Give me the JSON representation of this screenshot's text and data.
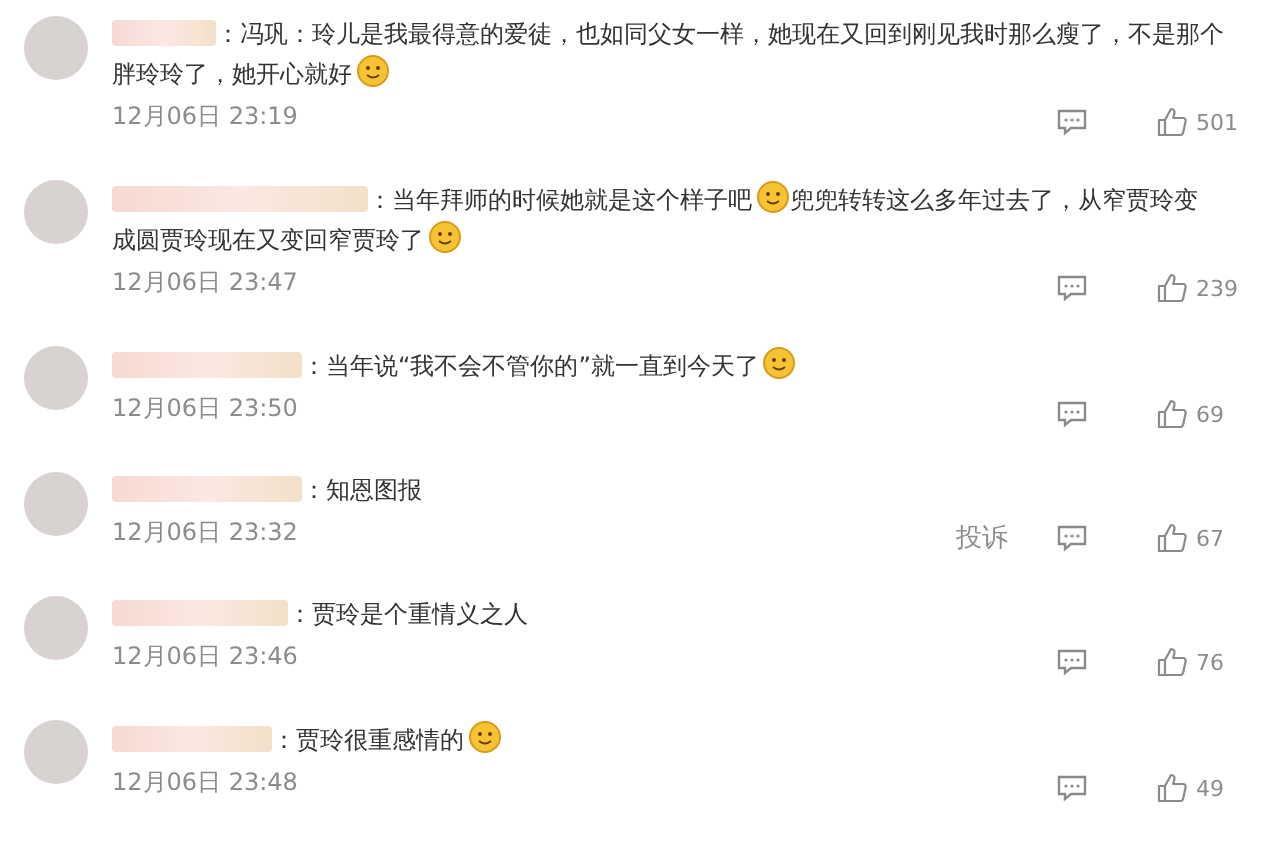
{
  "comments": [
    {
      "segments": [
        {
          "kind": "text",
          "text": "：冯巩：玲儿是我最得意的爱徒，也如同父女一样，她现在又回到刚见我时那么瘦了，不是那个"
        },
        {
          "kind": "break"
        },
        {
          "kind": "text",
          "text": "胖玲玲了，她开心就好"
        },
        {
          "kind": "emoji"
        }
      ],
      "time": "12月06日 23:19",
      "likes": "501"
    },
    {
      "segments": [
        {
          "kind": "text",
          "text": "：当年拜师的时候她就是这个样子吧"
        },
        {
          "kind": "emoji"
        },
        {
          "kind": "text",
          "text": "兜兜转转这么多年过去了，从窄贾玲变"
        },
        {
          "kind": "break"
        },
        {
          "kind": "text",
          "text": "成圆贾玲现在又变回窄贾玲了"
        },
        {
          "kind": "emoji"
        }
      ],
      "time": "12月06日 23:47",
      "likes": "239"
    },
    {
      "segments": [
        {
          "kind": "text",
          "text": "：当年说“我不会不管你的”就一直到今天了"
        },
        {
          "kind": "emoji"
        }
      ],
      "time": "12月06日 23:50",
      "likes": "69"
    },
    {
      "segments": [
        {
          "kind": "text",
          "text": "：知恩图报"
        }
      ],
      "time": "12月06日 23:32",
      "report": "投诉",
      "likes": "67"
    },
    {
      "segments": [
        {
          "kind": "text",
          "text": "：贾玲是个重情义之人"
        }
      ],
      "time": "12月06日 23:46",
      "likes": "76"
    },
    {
      "segments": [
        {
          "kind": "text",
          "text": "：贾玲很重感情的"
        },
        {
          "kind": "emoji"
        }
      ],
      "time": "12月06日 23:48",
      "likes": "49"
    }
  ]
}
